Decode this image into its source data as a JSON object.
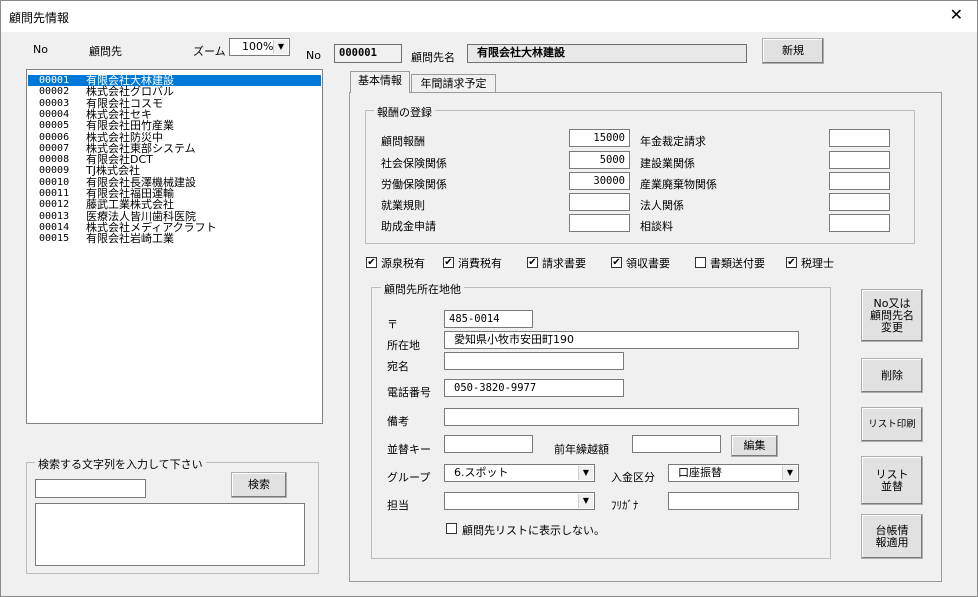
{
  "window": {
    "title": "顧問先情報",
    "close": "✕"
  },
  "header": {
    "no_col": "No",
    "name_col": "顧問先",
    "zoom_label": "ズーム",
    "zoom_value": "100%",
    "no_label": "No",
    "no_value": "000001",
    "name_label": "顧問先名",
    "name_value": "有限会社大林建設",
    "new_button": "新規"
  },
  "client_list": [
    {
      "no": "00001",
      "name": "有限会社大林建設"
    },
    {
      "no": "00002",
      "name": "株式会社グロバル"
    },
    {
      "no": "00003",
      "name": "有限会社コスモ"
    },
    {
      "no": "00004",
      "name": "株式会社セキ"
    },
    {
      "no": "00005",
      "name": "有限会社田竹産業"
    },
    {
      "no": "00006",
      "name": "株式会社防災中"
    },
    {
      "no": "00007",
      "name": "株式会社東部システム"
    },
    {
      "no": "00008",
      "name": "有限会社DCT"
    },
    {
      "no": "00009",
      "name": "TJ株式会社"
    },
    {
      "no": "00010",
      "name": "有限会社長澤機械建設"
    },
    {
      "no": "00011",
      "name": "有限会社福田運輸"
    },
    {
      "no": "00012",
      "name": "藤武工業株式会社"
    },
    {
      "no": "00013",
      "name": "医療法人皆川歯科医院"
    },
    {
      "no": "00014",
      "name": "株式会社メディアクラフト"
    },
    {
      "no": "00015",
      "name": "有限会社岩崎工業"
    }
  ],
  "search": {
    "legend": "検索する文字列を入力して下さい",
    "input_value": "",
    "button": "検索",
    "results": ""
  },
  "tabs": [
    {
      "label": "基本情報",
      "active": true
    },
    {
      "label": "年間請求予定",
      "active": false
    }
  ],
  "fees": {
    "legend": "報酬の登録",
    "left": [
      {
        "label": "顧問報酬",
        "value": "15000"
      },
      {
        "label": "社会保険関係",
        "value": "5000"
      },
      {
        "label": "労働保険関係",
        "value": "30000"
      },
      {
        "label": "就業規則",
        "value": ""
      },
      {
        "label": "助成金申請",
        "value": ""
      }
    ],
    "right": [
      {
        "label": "年金裁定請求",
        "value": ""
      },
      {
        "label": "建設業関係",
        "value": ""
      },
      {
        "label": "産業廃棄物関係",
        "value": ""
      },
      {
        "label": "法人関係",
        "value": ""
      },
      {
        "label": "相談料",
        "value": ""
      }
    ]
  },
  "flags": [
    {
      "label": "源泉税有",
      "checked": true
    },
    {
      "label": "消費税有",
      "checked": true
    },
    {
      "label": "請求書要",
      "checked": true
    },
    {
      "label": "領収書要",
      "checked": true
    },
    {
      "label": "書類送付要",
      "checked": false
    },
    {
      "label": "税理士",
      "checked": true
    }
  ],
  "address": {
    "legend": "顧問先所在地他",
    "postal_label": "〒",
    "postal_value": "485-0014",
    "address_label": "所在地",
    "address_value": "愛知県小牧市安田町190",
    "addressee_label": "宛名",
    "addressee_value": "",
    "phone_label": "電話番号",
    "phone_value": "050-3820-9977",
    "memo_label": "備考",
    "memo_value": "",
    "sort_key_label": "並替キー",
    "sort_key_value": "",
    "carryover_label": "前年繰越額",
    "carryover_value": "",
    "edit_button": "編集",
    "group_label": "グループ",
    "group_value": "6.スポット",
    "payment_label": "入金区分",
    "payment_value": "口座振替",
    "staff_label": "担当",
    "staff_value": "",
    "kana_label": "ﾌﾘｶﾞﾅ",
    "kana_value": "",
    "hide_label": "顧問先リストに表示しない。",
    "hide_checked": false
  },
  "side_buttons": {
    "rename": [
      "No又は",
      "顧問先名",
      "変更"
    ],
    "delete": "削除",
    "print_list": "リスト印刷",
    "sort_list": [
      "リスト",
      "並替"
    ],
    "ledger": [
      "台帳情",
      "報適用"
    ]
  }
}
